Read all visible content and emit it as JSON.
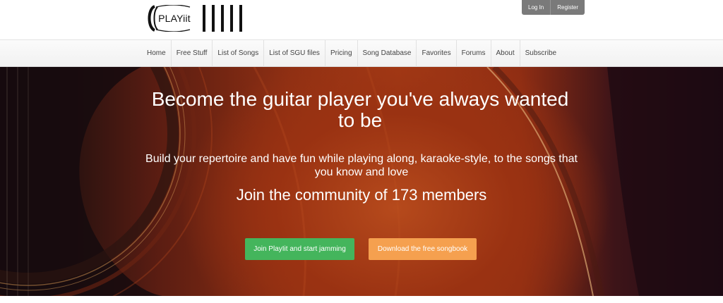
{
  "header": {
    "logo": {
      "text": "PLAYiit"
    },
    "auth": {
      "login_label": "Log In",
      "register_label": "Register"
    }
  },
  "nav": {
    "items": [
      {
        "label": "Home"
      },
      {
        "label": "Free Stuff"
      },
      {
        "label": "List of Songs"
      },
      {
        "label": "List of SGU files"
      },
      {
        "label": "Pricing"
      },
      {
        "label": "Song Database"
      },
      {
        "label": "Favorites"
      },
      {
        "label": "Forums"
      },
      {
        "label": "About"
      },
      {
        "label": "Subscribe"
      }
    ]
  },
  "hero": {
    "title": "Become the guitar player you've always wanted to be",
    "subtitle": "Build your repertoire and have fun while playing along, karaoke-style, to the songs that you know and love",
    "community": "Join the community of 173 members",
    "join_button": "Join PlayIit and start jamming",
    "download_button": "Download the free songbook"
  },
  "colors": {
    "join_button": "#44b55c",
    "download_button": "#f5a04f",
    "auth_bar": "#7a7a7a",
    "hero_accent": "#a53b16"
  }
}
